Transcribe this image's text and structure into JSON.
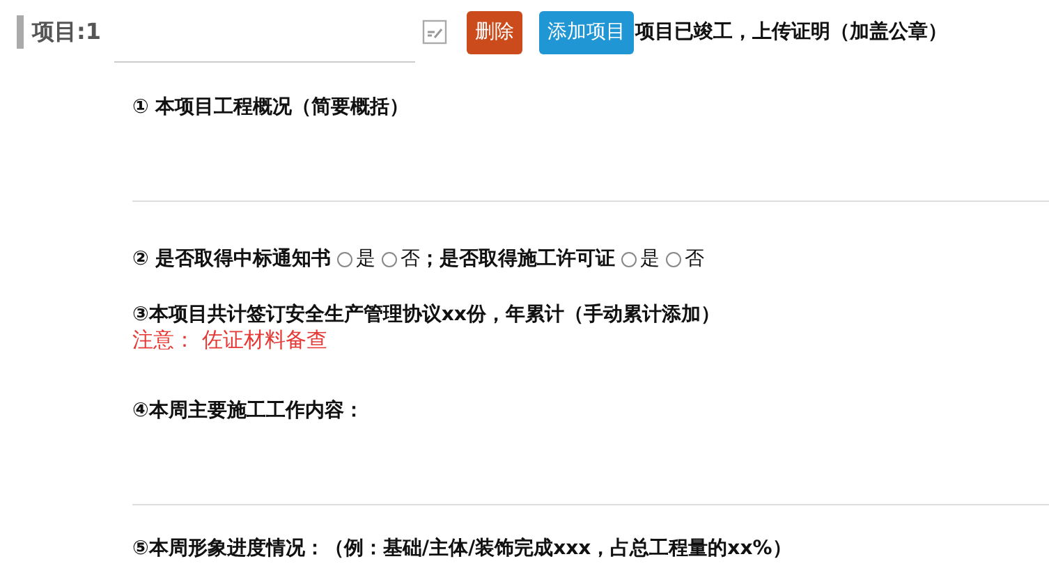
{
  "header": {
    "title": "项目:1",
    "buttons": [
      {
        "label": "删除",
        "kind": "danger"
      },
      {
        "label": "添加项目",
        "kind": "primary"
      }
    ],
    "completion_text": "项目已竣工，上传证明（加盖公章）"
  },
  "sections": [
    {
      "kind": "text",
      "label": "① 本项目工程概况（简要概括）",
      "divider": true
    },
    {
      "kind": "radios",
      "groups": [
        {
          "label": "② 是否取得中标通知书",
          "options": [
            {
              "label": "是",
              "selected": false
            },
            {
              "label": "否",
              "selected": false
            }
          ]
        },
        {
          "label": "；是否取得施工许可证",
          "options": [
            {
              "label": "是",
              "selected": false
            },
            {
              "label": "否",
              "selected": false
            }
          ]
        }
      ]
    },
    {
      "kind": "note",
      "label": "③本项目共计签订安全生产管理协议xx份，年累计（手动累计添加）",
      "note": "注意： 佐证材料备查"
    },
    {
      "kind": "text",
      "label": "④本周主要施工工作内容：",
      "divider": true
    },
    {
      "kind": "text",
      "label": "⑤本周形象进度情况：（例：基础/主体/装饰完成xxx，占总工程量的xx%）",
      "divider": false
    }
  ]
}
